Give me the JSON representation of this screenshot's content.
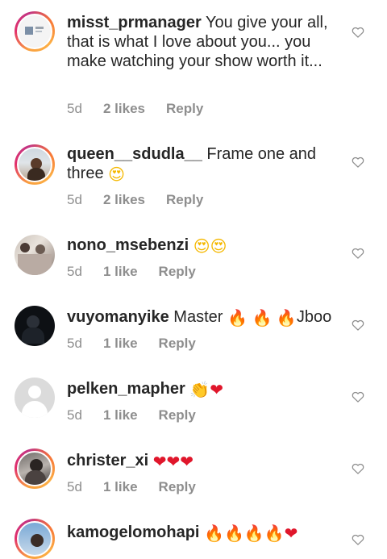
{
  "comments": [
    {
      "username": "misst_prmanager",
      "text": "You give your all, that is what I love about you... you make watching your show worth it...",
      "emojis": [],
      "time": "5d",
      "likes": "2 likes",
      "reply": "Reply",
      "avatar": "storied-photo"
    },
    {
      "username": "queen__sdudla__",
      "text": "Frame one and three",
      "emojis": [
        "😍"
      ],
      "time": "5d",
      "likes": "2 likes",
      "reply": "Reply",
      "avatar": "storied-photo"
    },
    {
      "username": "nono_msebenzi",
      "text": "",
      "emojis": [
        "😍",
        "😍"
      ],
      "time": "5d",
      "likes": "1 like",
      "reply": "Reply",
      "avatar": "photo"
    },
    {
      "username": "vuyomanyike",
      "text": "Master",
      "emojis": [
        "🔥",
        "🔥",
        "🔥"
      ],
      "text_after": "Jboo",
      "time": "5d",
      "likes": "1 like",
      "reply": "Reply",
      "avatar": "photo"
    },
    {
      "username": "pelken_mapher",
      "text": "",
      "emojis": [
        "👏",
        "❤"
      ],
      "time": "5d",
      "likes": "1 like",
      "reply": "Reply",
      "avatar": "default-silhouette"
    },
    {
      "username": "christer_xi",
      "text": "",
      "emojis": [
        "❤",
        "❤",
        "❤"
      ],
      "time": "5d",
      "likes": "1 like",
      "reply": "Reply",
      "avatar": "storied-photo"
    },
    {
      "username": "kamogelomohapi",
      "text": "",
      "emojis": [
        "🔥",
        "🔥",
        "🔥",
        "🔥",
        "❤"
      ],
      "time": "",
      "likes": "",
      "reply": "",
      "avatar": "storied-photo"
    }
  ],
  "colors": {
    "text": "#262626",
    "meta": "#8e8e8e",
    "heart_outline": "#8e8e8e",
    "emoji_heart": "#e0162b"
  },
  "icons": {
    "like": "heart-outline-icon"
  }
}
